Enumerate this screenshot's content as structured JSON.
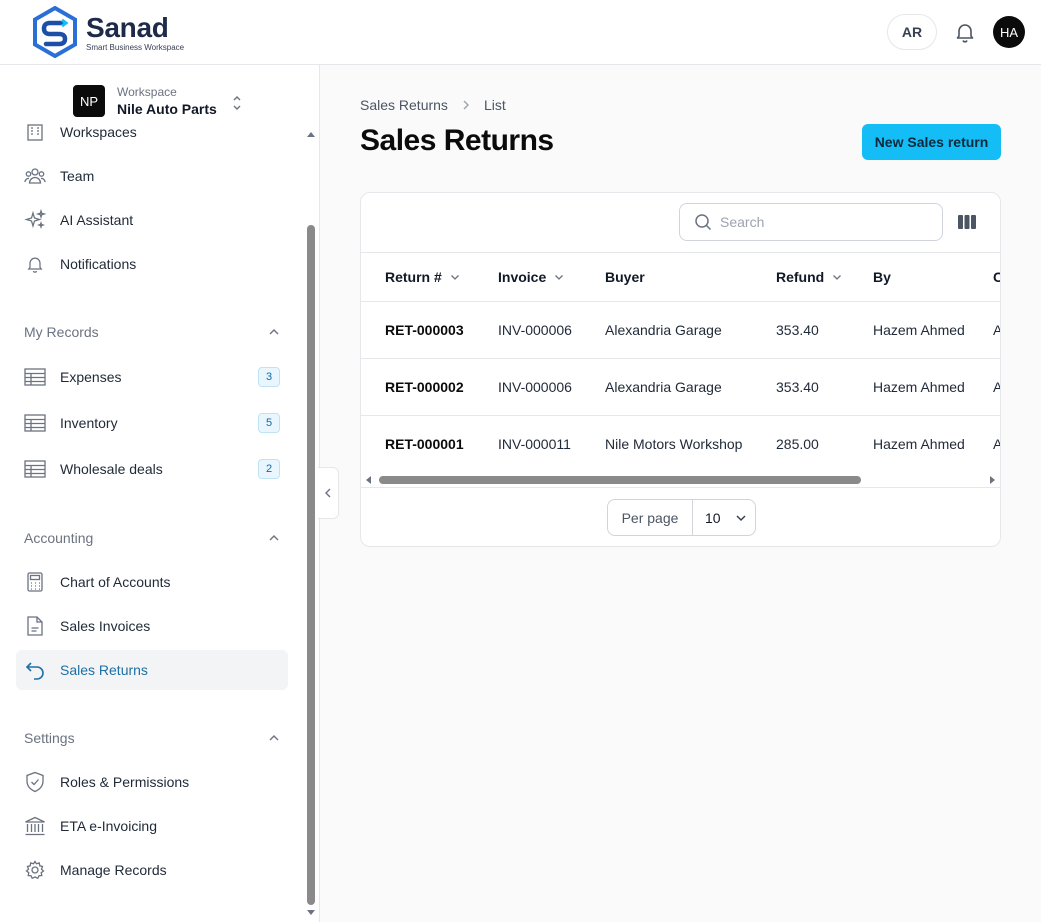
{
  "brand": {
    "name": "Sanad",
    "tagline": "Smart Business Workspace",
    "colors": {
      "primary": "#2563c9",
      "accent": "#14bdf5",
      "dark": "#1e2a4a"
    }
  },
  "topbar": {
    "lang_label": "AR",
    "bell_icon": "bell-icon",
    "avatar_initials": "HA"
  },
  "workspace": {
    "label": "Workspace",
    "badge": "NP",
    "name": "Nile Auto Parts"
  },
  "sidebar": {
    "top_items": [
      {
        "label": "Workspaces",
        "icon": "building-icon"
      },
      {
        "label": "Team",
        "icon": "users-icon"
      },
      {
        "label": "AI Assistant",
        "icon": "sparkles-icon"
      },
      {
        "label": "Notifications",
        "icon": "bell-icon"
      }
    ],
    "my_records": {
      "title": "My Records",
      "items": [
        {
          "label": "Expenses",
          "count": "3",
          "icon": "table-icon"
        },
        {
          "label": "Inventory",
          "count": "5",
          "icon": "table-icon"
        },
        {
          "label": "Wholesale deals",
          "count": "2",
          "icon": "table-icon"
        }
      ]
    },
    "accounting": {
      "title": "Accounting",
      "items": [
        {
          "label": "Chart of Accounts",
          "icon": "calculator-icon"
        },
        {
          "label": "Sales Invoices",
          "icon": "document-icon"
        },
        {
          "label": "Sales Returns",
          "icon": "return-arrow-icon"
        }
      ]
    },
    "settings": {
      "title": "Settings",
      "items": [
        {
          "label": "Roles & Permissions",
          "icon": "shield-icon"
        },
        {
          "label": "ETA e-Invoicing",
          "icon": "bank-icon"
        },
        {
          "label": "Manage Records",
          "icon": "gear-icon"
        }
      ]
    }
  },
  "breadcrumb": [
    "Sales Returns",
    "List"
  ],
  "page": {
    "title": "Sales Returns",
    "new_button": "New Sales return"
  },
  "table": {
    "search_placeholder": "Search",
    "columns": [
      "Return #",
      "Invoice",
      "Buyer",
      "Refund",
      "By",
      "C"
    ],
    "rows": [
      {
        "return_no": "RET-000003",
        "invoice": "INV-000006",
        "buyer": "Alexandria Garage",
        "refund": "353.40",
        "by": "Hazem Ahmed",
        "extra": "A"
      },
      {
        "return_no": "RET-000002",
        "invoice": "INV-000006",
        "buyer": "Alexandria Garage",
        "refund": "353.40",
        "by": "Hazem Ahmed",
        "extra": "A"
      },
      {
        "return_no": "RET-000001",
        "invoice": "INV-000011",
        "buyer": "Nile Motors Workshop",
        "refund": "285.00",
        "by": "Hazem Ahmed",
        "extra": "A"
      }
    ],
    "per_page_label": "Per page",
    "per_page_value": "10"
  }
}
